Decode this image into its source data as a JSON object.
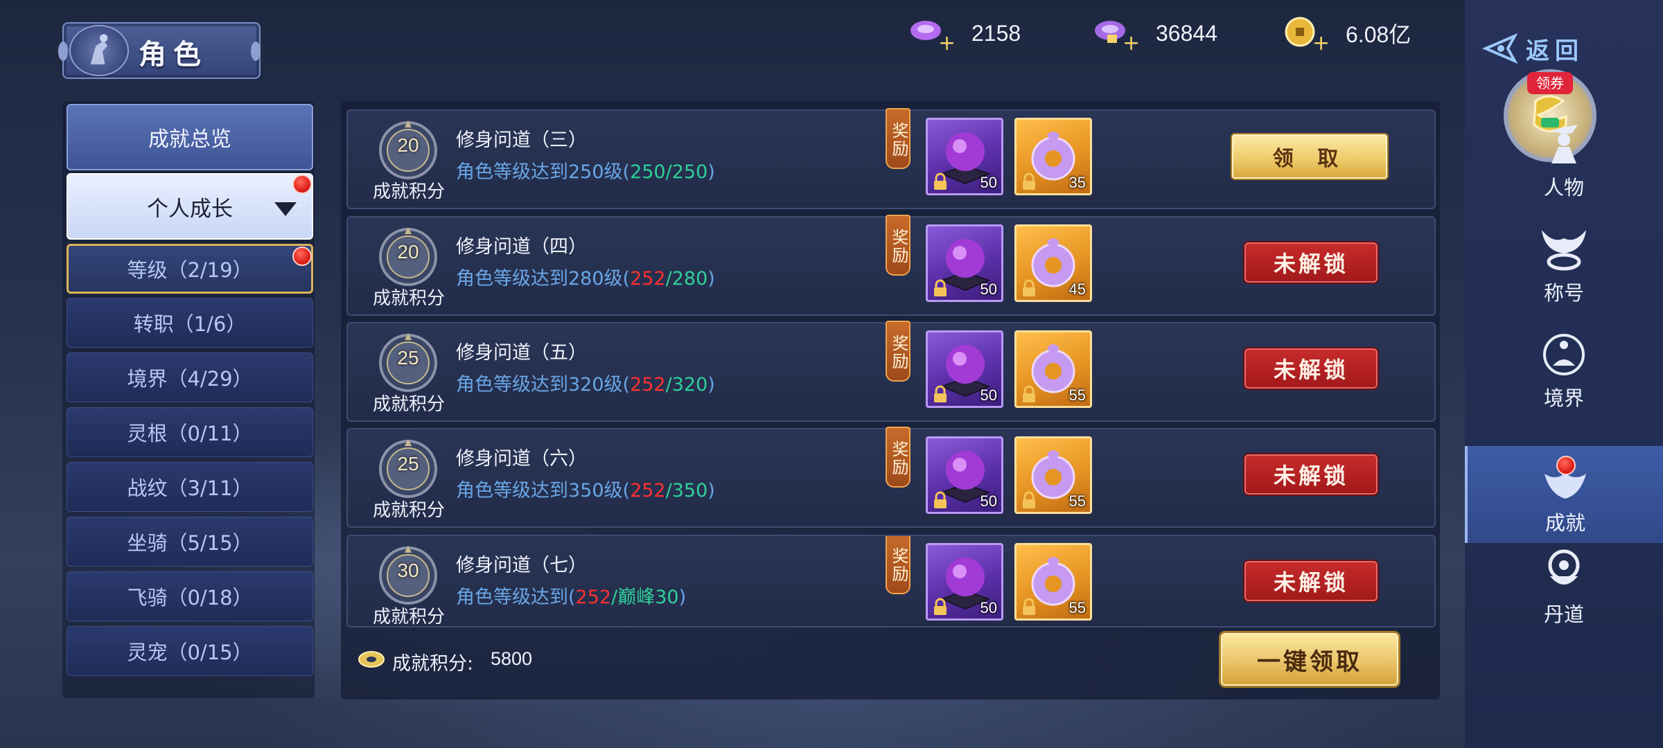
{
  "header": {
    "title": "角色",
    "currencies": [
      {
        "icon": "jade-plus-icon",
        "value": "2158"
      },
      {
        "icon": "jade-bind-plus-icon",
        "value": "36844"
      },
      {
        "icon": "gold-coin-plus-icon",
        "value": "6.08亿"
      }
    ]
  },
  "sidebar": {
    "overview": "成就总览",
    "growth": "个人成长",
    "items": [
      {
        "label": "等级（2/19）",
        "badge": true
      },
      {
        "label": "转职（1/6）"
      },
      {
        "label": "境界（4/29）"
      },
      {
        "label": "灵根（0/11）"
      },
      {
        "label": "战纹（3/11）"
      },
      {
        "label": "坐骑（5/15）"
      },
      {
        "label": "飞骑（0/18）"
      },
      {
        "label": "灵宠（0/15）"
      }
    ]
  },
  "achievements": [
    {
      "points": "20",
      "points_label": "成就积分",
      "title": "修身问道（三）",
      "desc_prefix": "角色等级达到250级(",
      "progress_current": "250",
      "progress_sep": "/",
      "progress_target": "250",
      "desc_suffix": ")",
      "current_color": "green",
      "reward_label": "奖励",
      "rewards": [
        {
          "type": "purple-orb",
          "count": "50"
        },
        {
          "type": "jade-ring",
          "count": "35"
        }
      ],
      "action": "领 取",
      "action_state": "claimable"
    },
    {
      "points": "20",
      "points_label": "成就积分",
      "title": "修身问道（四）",
      "desc_prefix": "角色等级达到280级(",
      "progress_current": "252",
      "progress_sep": "/",
      "progress_target": "280",
      "desc_suffix": ")",
      "current_color": "red",
      "reward_label": "奖励",
      "rewards": [
        {
          "type": "purple-orb",
          "count": "50"
        },
        {
          "type": "jade-ring",
          "count": "45"
        }
      ],
      "action": "未解锁",
      "action_state": "locked"
    },
    {
      "points": "25",
      "points_label": "成就积分",
      "title": "修身问道（五）",
      "desc_prefix": "角色等级达到320级(",
      "progress_current": "252",
      "progress_sep": "/",
      "progress_target": "320",
      "desc_suffix": ")",
      "current_color": "red",
      "reward_label": "奖励",
      "rewards": [
        {
          "type": "purple-orb",
          "count": "50"
        },
        {
          "type": "jade-ring",
          "count": "55"
        }
      ],
      "action": "未解锁",
      "action_state": "locked"
    },
    {
      "points": "25",
      "points_label": "成就积分",
      "title": "修身问道（六）",
      "desc_prefix": "角色等级达到350级(",
      "progress_current": "252",
      "progress_sep": "/",
      "progress_target": "350",
      "desc_suffix": ")",
      "current_color": "red",
      "reward_label": "奖励",
      "rewards": [
        {
          "type": "purple-orb",
          "count": "50"
        },
        {
          "type": "jade-ring",
          "count": "55"
        }
      ],
      "action": "未解锁",
      "action_state": "locked"
    },
    {
      "points": "30",
      "points_label": "成就积分",
      "title": "修身问道（七）",
      "desc_prefix": "角色等级达到(",
      "progress_current": "252",
      "progress_sep": "/",
      "progress_target": "巅峰30",
      "desc_suffix": ")",
      "current_color": "red",
      "reward_label": "奖励",
      "rewards": [
        {
          "type": "purple-orb",
          "count": "50"
        },
        {
          "type": "jade-ring",
          "count": "55"
        }
      ],
      "action": "未解锁",
      "action_state": "locked"
    }
  ],
  "footer": {
    "score_label": "成就积分:",
    "score_value": "5800",
    "claim_all": "一键领取"
  },
  "right_nav": {
    "back": "返回",
    "coupon_badge": "领券",
    "items": [
      {
        "label": "人物",
        "icon": "character-icon"
      },
      {
        "label": "称号",
        "icon": "title-icon"
      },
      {
        "label": "境界",
        "icon": "realm-icon"
      },
      {
        "label": "成就",
        "icon": "achievement-icon",
        "active": true,
        "badge": true
      },
      {
        "label": "丹道",
        "icon": "alchemy-icon"
      }
    ]
  }
}
